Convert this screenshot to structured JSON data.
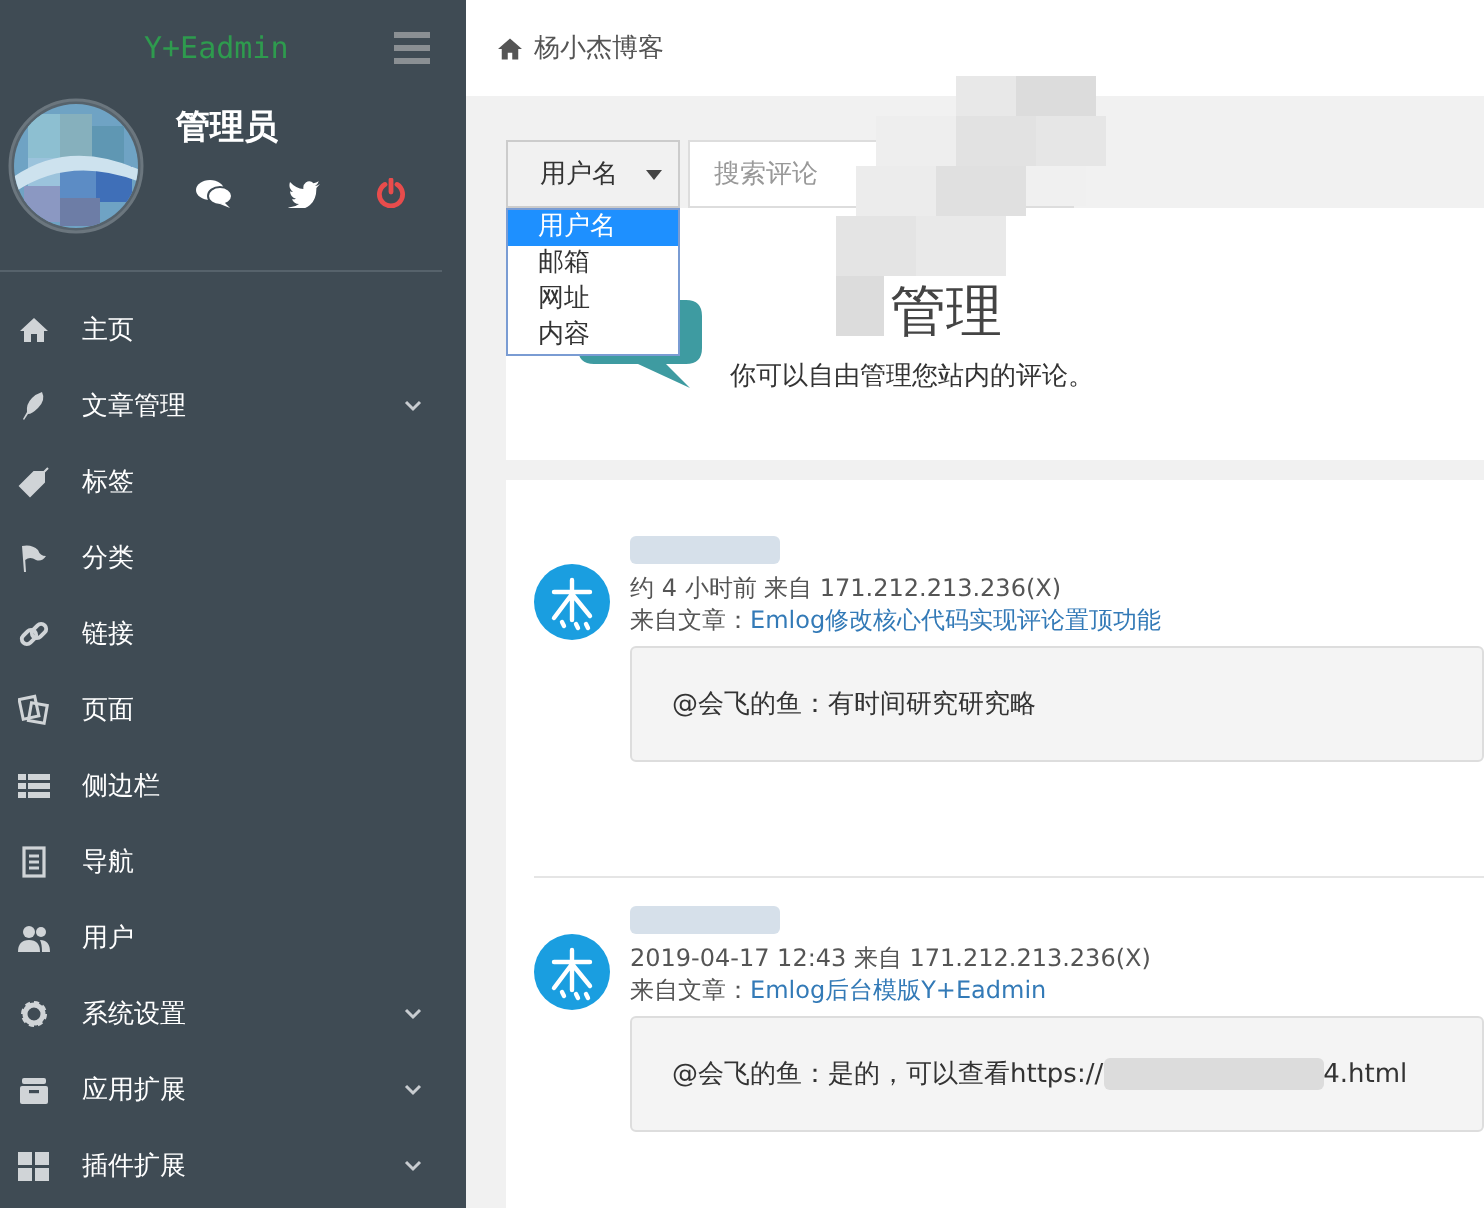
{
  "sidebar": {
    "logo": "Y+Eadmin",
    "user": {
      "name": "管理员"
    },
    "menu": [
      {
        "label": "主页",
        "expandable": false
      },
      {
        "label": "文章管理",
        "expandable": true
      },
      {
        "label": "标签",
        "expandable": false
      },
      {
        "label": "分类",
        "expandable": false
      },
      {
        "label": "链接",
        "expandable": false
      },
      {
        "label": "页面",
        "expandable": false
      },
      {
        "label": "侧边栏",
        "expandable": false
      },
      {
        "label": "导航",
        "expandable": false
      },
      {
        "label": "用户",
        "expandable": false
      },
      {
        "label": "系统设置",
        "expandable": true
      },
      {
        "label": "应用扩展",
        "expandable": true
      },
      {
        "label": "插件扩展",
        "expandable": true
      }
    ]
  },
  "breadcrumb": "杨小杰博客",
  "search": {
    "select": {
      "value": "用户名",
      "expanded": true,
      "options": [
        {
          "label": "用户名",
          "selected": true
        },
        {
          "label": "邮箱",
          "selected": false
        },
        {
          "label": "网址",
          "selected": false
        },
        {
          "label": "内容",
          "selected": false
        }
      ]
    },
    "placeholder": "搜索评论"
  },
  "header": {
    "title": "管理",
    "subtitle": "你可以自由管理您站内的评论。"
  },
  "comments": [
    {
      "meta": "约 4 小时前 来自 171.212.213.236(X)",
      "source_label": "来自文章：",
      "source": "Emlog修改核心代码实现评论置顶功能",
      "text": "@会飞的鱼：有时间研究研究略"
    },
    {
      "meta": "2019-04-17 12:43 来自 171.212.213.236(X)",
      "source_label": "来自文章：",
      "source": "Emlog后台模版Y+Eadmin",
      "text": "@会飞的鱼：是的，可以查看https://",
      "text_end": "4.html"
    }
  ]
}
